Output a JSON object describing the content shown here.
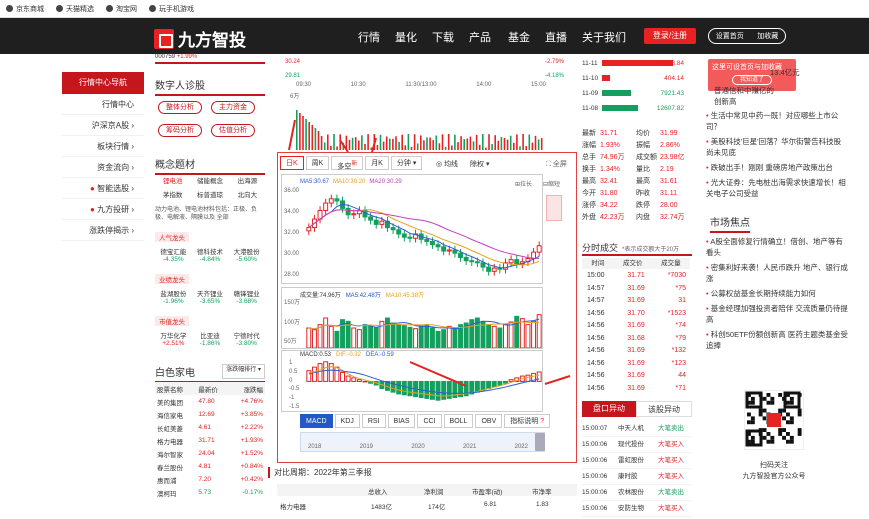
{
  "toplinks": [
    "京东商城",
    "天猫精选",
    "淘宝网",
    "玩手机游戏"
  ],
  "brand": {
    "name": "九方智投"
  },
  "nav": {
    "items": [
      "行情",
      "量化",
      "下载",
      "产品",
      "基金",
      "直播",
      "关于我们"
    ],
    "login": "登录/注册",
    "home": "设置首页",
    "fav": "加收藏"
  },
  "popup": {
    "text": "这里可设首页与加收藏",
    "btn": "我知道了"
  },
  "left_nav": {
    "header": "行情中心导航",
    "items": [
      "行情中心",
      "沪深京A股",
      "板块行情",
      "资金流向",
      "智能选股",
      "九方投研",
      "涨跌停揭示"
    ]
  },
  "top_strip": {
    "code": "000759",
    "pct": "+1.99%",
    "p1": "30.24",
    "p2": "29.81",
    "times": [
      "09:30",
      "10:30",
      "11:30/13:00",
      "14:00",
      "15:00"
    ],
    "r1": "-2.79%",
    "r2": "-4.18%",
    "vol": "6万"
  },
  "diagnose": {
    "title": "数字人诊股",
    "pills": [
      "整体分析",
      "主力资金",
      "筹码分析",
      "估值分析"
    ]
  },
  "concepts": {
    "title": "概念题材",
    "tags": [
      "锂电池",
      "储能概念",
      "出海源",
      "茅指数",
      "标普道琼",
      "北向大"
    ],
    "desc": "动力电池、锂电池材料包括：正极、负极、电解液、隔膜以及 全部",
    "groups": [
      {
        "name": "人气龙头",
        "items": [
          {
            "n": "德宝汇能",
            "p": "-4.35%"
          },
          {
            "n": "德科技术",
            "p": "-4.84%"
          },
          {
            "n": "大港股份",
            "p": "-5.60%"
          }
        ]
      },
      {
        "name": "业绩龙头",
        "items": [
          {
            "n": "盐湖股份",
            "p": "-1.96%"
          },
          {
            "n": "天齐锂业",
            "p": "-3.65%"
          },
          {
            "n": "赣锋锂业",
            "p": "-3.68%"
          }
        ]
      },
      {
        "name": "市值龙头",
        "items": [
          {
            "n": "万华化学",
            "p": "+2.51%"
          },
          {
            "n": "比亚迪",
            "p": "-1.86%"
          },
          {
            "n": "宁德时代",
            "p": "-3.80%"
          }
        ]
      }
    ]
  },
  "appliance": {
    "title": "白色家电",
    "select": "涨跌幅排行",
    "headers": [
      "股票名称",
      "最新价",
      "涨跌幅"
    ],
    "rows": [
      [
        "美的集团",
        "47.80",
        "+4.76%"
      ],
      [
        "海信家电",
        "12.69",
        "+3.85%"
      ],
      [
        "长虹美菱",
        "4.61",
        "+2.22%"
      ],
      [
        "格力电器",
        "31.71",
        "+1.93%"
      ],
      [
        "海尔智家",
        "24.04",
        "+1.52%"
      ],
      [
        "春兰股份",
        "4.81",
        "+0.84%"
      ],
      [
        "惠而浦",
        "7.20",
        "+0.42%"
      ],
      [
        "澳柯玛",
        "5.73",
        "-0.17%"
      ]
    ]
  },
  "kline": {
    "tabs": [
      "日K",
      "周K",
      "多空",
      "月K",
      "分钟"
    ],
    "tag_badge": "新",
    "avg": "均线",
    "rights": "除权",
    "fullscreen": "全屏",
    "ma": [
      {
        "l": "MA5:30.67",
        "c": "#2d5bd8"
      },
      {
        "l": "MA10:30.20",
        "c": "#e6a21e"
      },
      {
        "l": "MA20:30.29",
        "c": "#c03fc0"
      }
    ],
    "zoom": "拉长",
    "shrink": "缩短",
    "yticks": [
      "36.00",
      "34.00",
      "32.00",
      "30.00",
      "28.00"
    ],
    "vol_label": "成交量:74.96万",
    "vol_ma5": "MA5:42.48万",
    "vol_ma10": "MA10:45.38万",
    "vol_ticks": [
      "150万",
      "100万",
      "50万"
    ],
    "macd_label": "MACD:0.53",
    "dif": "DIF:-0.32",
    "dea": "DEA:-0.59",
    "macd_ticks": [
      "1",
      "0.5",
      "0",
      "-0.5",
      "-1",
      "-1.5"
    ],
    "ind_tabs": [
      "MACD",
      "KDJ",
      "RSI",
      "BIAS",
      "CCI",
      "BOLL",
      "OBV",
      "指标说明"
    ],
    "years": [
      "2018",
      "2019",
      "2020",
      "2021",
      "2022"
    ],
    "candles": [
      32.6,
      33.4,
      34.2,
      34.9,
      35.3,
      35.1,
      34.4,
      33.8,
      33.9,
      34.2,
      33.6,
      33.3,
      32.9,
      33.2,
      32.6,
      32.4,
      32.0,
      31.7,
      31.6,
      32.0,
      31.5,
      31.3,
      31.0,
      30.8,
      30.4,
      30.5,
      30.2,
      29.8,
      29.5,
      29.4,
      29.3,
      28.9,
      28.5,
      28.8,
      28.7,
      29.3,
      29.6,
      29.2,
      29.4,
      29.7,
      30.3,
      30.9
    ],
    "vols": [
      60,
      55,
      70,
      90,
      65,
      50,
      85,
      80,
      60,
      55,
      70,
      65,
      60,
      80,
      90,
      75,
      70,
      68,
      62,
      58,
      66,
      70,
      60,
      50,
      55,
      65,
      60,
      70,
      75,
      85,
      90,
      80,
      70,
      65,
      60,
      72,
      78,
      95,
      88,
      70,
      80,
      100
    ],
    "macd": [
      0.6,
      0.8,
      1.0,
      1.1,
      1.0,
      0.8,
      0.5,
      0.3,
      0.2,
      0.1,
      0.0,
      -0.1,
      -0.2,
      -0.4,
      -0.5,
      -0.6,
      -0.7,
      -0.75,
      -0.8,
      -0.85,
      -0.9,
      -0.95,
      -1.0,
      -1.05,
      -1.0,
      -0.95,
      -0.9,
      -0.85,
      -0.8,
      -0.7,
      -0.6,
      -0.5,
      -0.4,
      -0.3,
      -0.2,
      -0.1,
      0.1,
      0.2,
      0.3,
      0.35,
      0.45,
      0.53
    ]
  },
  "report": {
    "title": "对比周期：2022年第三季报",
    "headers": [
      "总收入",
      "净利润",
      "市盈率(动)",
      "市净率"
    ],
    "row": [
      "格力电器",
      "1483亿",
      "174亿",
      "6.81",
      "1.83"
    ]
  },
  "sectors": [
    {
      "n": "11-11",
      "v": "35938.84",
      "w": 70
    },
    {
      "n": "11-10",
      "v": "404.14",
      "w": 8
    },
    {
      "n": "11-09",
      "v": "7921.43",
      "w": 28
    },
    {
      "n": "11-08",
      "v": "12607.82",
      "w": 35
    }
  ],
  "quote": [
    [
      "最新",
      "31.71",
      "均价",
      "31.99"
    ],
    [
      "涨幅",
      "1.93%",
      "振幅",
      "2.86%"
    ],
    [
      "总手",
      "74.96万",
      "成交额",
      "23.98亿"
    ],
    [
      "换手",
      "1.34%",
      "量比",
      "2.19"
    ],
    [
      "最高",
      "32.41",
      "最高",
      "31.61"
    ],
    [
      "今开",
      "31.80",
      "昨收",
      "31.11"
    ],
    [
      "涨停",
      "34.22",
      "跌停",
      "28.00"
    ],
    [
      "外盘",
      "42.23万",
      "内盘",
      "32.74万"
    ]
  ],
  "ticks": {
    "title": "分时成交",
    "note": "*表示成交额大于20万",
    "headers": [
      "时间",
      "成交价",
      "成交量"
    ],
    "rows": [
      [
        "15:00",
        "31.71",
        "*7030"
      ],
      [
        "14:57",
        "31.69",
        "*75"
      ],
      [
        "14:57",
        "31.69",
        "31"
      ],
      [
        "14:56",
        "31.70",
        "*1523"
      ],
      [
        "14:56",
        "31.69",
        "*74"
      ],
      [
        "14:56",
        "31.68",
        "*79"
      ],
      [
        "14:56",
        "31.69",
        "*132"
      ],
      [
        "14:56",
        "31.69",
        "*123"
      ],
      [
        "14:56",
        "31.69",
        "44"
      ],
      [
        "14:56",
        "31.69",
        "*71"
      ]
    ]
  },
  "disk": {
    "tabs": [
      "盘口异动",
      "该股异动"
    ],
    "rows": [
      [
        "15:00:07",
        "中天人机",
        "大笔卖出"
      ],
      [
        "15:00:06",
        "现代投份",
        "大笔买入"
      ],
      [
        "15:00:06",
        "雷虹股份",
        "大笔买入"
      ],
      [
        "15:00:06",
        "康时胶",
        "大笔买入"
      ],
      [
        "15:00:06",
        "农林股份",
        "大笔卖出"
      ],
      [
        "15:00:06",
        "安防生物",
        "大笔买入"
      ]
    ]
  },
  "news": {
    "top_value": "13.4亿元",
    "items": [
      "普通信和中赚亿的",
      "创新高",
      "生活中常见中药一既！对应哪些上市公司？",
      "美股科技'巨星'回落？华尔街警告科技股尚未见底",
      "跌破出手！刚刚 重磅房地产政策出台",
      "光大证券：先电桩出海需求快速增长！相关电子公司受益"
    ],
    "focus_title": "市场焦点",
    "focus": [
      "A股全面修复行情确立！借创、地产等有看头",
      "密集利好来袭！人民币跌升 地产、银行成涨",
      "公募权益基金长期持续能力如何",
      "基金经理加强投资者陪伴 交流质量仍待提高",
      "科创50ETF份额创新高 医药主题类基金受追捧"
    ],
    "qr_label": "扫码关注",
    "qr_sub": "九方智投官方公众号"
  }
}
